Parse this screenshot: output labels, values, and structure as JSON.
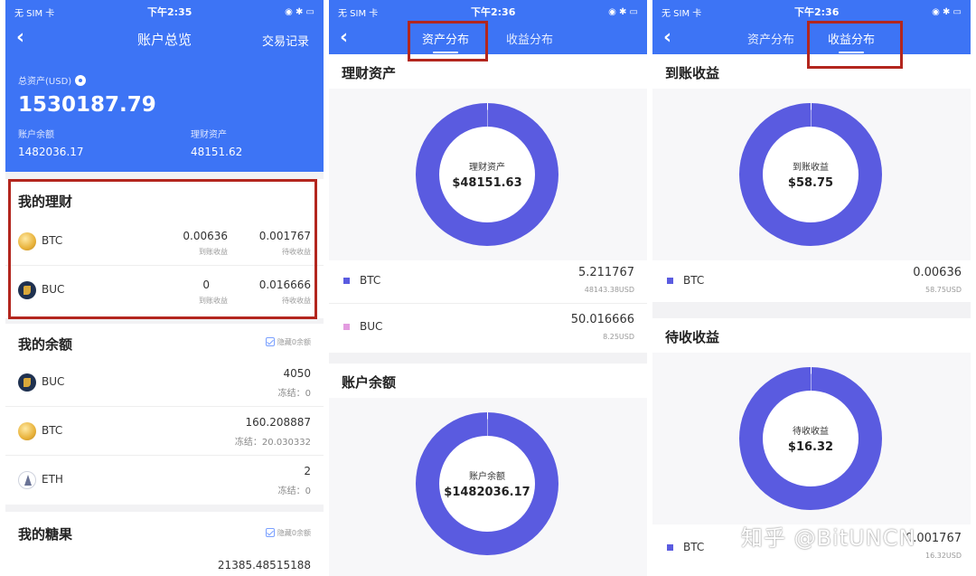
{
  "status": {
    "carrier": "无 SIM 卡",
    "time1": "下午2:35",
    "time2": "下午2:36",
    "time3": "下午2:36"
  },
  "screen1": {
    "title": "账户总览",
    "right_link": "交易记录",
    "total_label": "总资产(USD)",
    "total_value": "1530187.79",
    "balance_label": "账户余额",
    "balance_value": "1482036.17",
    "finance_label": "理财资产",
    "finance_value": "48151.62",
    "my_finance": {
      "title": "我的理财",
      "rows": [
        {
          "coin": "BTC",
          "received": "0.00636",
          "received_label": "到账收益",
          "pending": "0.001767",
          "pending_label": "待收收益"
        },
        {
          "coin": "BUC",
          "received": "0",
          "received_label": "到账收益",
          "pending": "0.016666",
          "pending_label": "待收收益"
        }
      ]
    },
    "my_balance": {
      "title": "我的余额",
      "hide_zero": "隐藏0余额",
      "rows": [
        {
          "coin": "BUC",
          "amount": "4050",
          "frozen": "冻结：0"
        },
        {
          "coin": "BTC",
          "amount": "160.208887",
          "frozen": "冻结：20.030332"
        },
        {
          "coin": "ETH",
          "amount": "2",
          "frozen": "冻结：0"
        }
      ]
    },
    "my_candy": {
      "title": "我的糖果",
      "hide_zero": "隐藏0余额",
      "amount": "21385.48515188"
    }
  },
  "screen2": {
    "tab_asset": "资产分布",
    "tab_income": "收益分布",
    "finance_section": "理财资产",
    "finance_donut_label": "理财资产",
    "finance_donut_value": "$48151.63",
    "finance_legend": [
      {
        "coin": "BTC",
        "amount": "5.211767",
        "usd": "48143.38USD",
        "color": "#5a5be0"
      },
      {
        "coin": "BUC",
        "amount": "50.016666",
        "usd": "8.25USD",
        "color": "#e39ce0"
      }
    ],
    "balance_section": "账户余额",
    "balance_donut_label": "账户余额",
    "balance_donut_value": "$1482036.17"
  },
  "screen3": {
    "tab_asset": "资产分布",
    "tab_income": "收益分布",
    "received_section": "到账收益",
    "received_donut_label": "到账收益",
    "received_donut_value": "$58.75",
    "received_legend": [
      {
        "coin": "BTC",
        "amount": "0.00636",
        "usd": "58.75USD",
        "color": "#5a5be0"
      }
    ],
    "pending_section": "待收收益",
    "pending_donut_label": "待收收益",
    "pending_donut_value": "$16.32",
    "pending_legend": [
      {
        "coin": "BTC",
        "amount": "0.001767",
        "usd": "16.32USD",
        "color": "#5a5be0"
      }
    ]
  },
  "chart_data": [
    {
      "type": "pie",
      "title": "理财资产",
      "categories": [
        "BTC",
        "BUC"
      ],
      "values": [
        48143.38,
        8.25
      ],
      "colors": [
        "#5a5be0",
        "#e39ce0"
      ]
    },
    {
      "type": "pie",
      "title": "账户余额",
      "categories": [],
      "values": [
        1482036.17
      ],
      "colors": [
        "#5a5be0"
      ]
    },
    {
      "type": "pie",
      "title": "到账收益",
      "categories": [
        "BTC"
      ],
      "values": [
        58.75
      ],
      "colors": [
        "#5a5be0"
      ]
    },
    {
      "type": "pie",
      "title": "待收收益",
      "categories": [
        "BTC"
      ],
      "values": [
        16.32
      ],
      "colors": [
        "#5a5be0"
      ]
    }
  ],
  "watermark": "知乎 @BitUNCN",
  "colors": {
    "primary": "#3d74f5",
    "donut": "#5a5be0",
    "highlight": "#b3261e"
  }
}
